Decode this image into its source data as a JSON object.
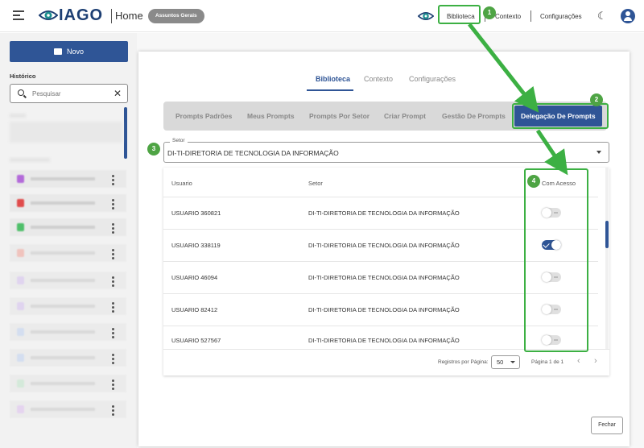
{
  "header": {
    "logo_text": "IAGO",
    "home_title": "Home",
    "chip_label": "Assuntos Gerais",
    "nav": {
      "biblioteca": "Biblioteca",
      "contexto": "Contexto",
      "configuracoes": "Configurações"
    },
    "theme_icon": "moon-icon",
    "avatar_icon": "user-icon"
  },
  "sidebar": {
    "novo_label": "Novo",
    "historico_label": "Histórico",
    "search_placeholder": "Pesquisar"
  },
  "modal": {
    "tabs": [
      "Biblioteca",
      "Contexto",
      "Configurações"
    ],
    "active_tab": "Biblioteca",
    "subtabs": [
      "Prompts Padrões",
      "Meus Prompts",
      "Prompts Por Setor",
      "Criar Prompt",
      "Gestão De Prompts",
      "Delegação De Prompts"
    ],
    "active_subtab": "Delegação De Prompts",
    "setor_label": "Setor",
    "setor_value": "DI-TI-DIRETORIA DE TECNOLOGIA DA INFORMAÇÃO",
    "table": {
      "headers": [
        "Usuario",
        "Setor",
        "Com Acesso"
      ],
      "rows": [
        {
          "usuario": "USUARIO 360821",
          "setor": "DI-TI-DIRETORIA DE TECNOLOGIA DA INFORMAÇÃO",
          "acesso": false
        },
        {
          "usuario": "USUARIO 338119",
          "setor": "DI-TI-DIRETORIA DE TECNOLOGIA DA INFORMAÇÃO",
          "acesso": true
        },
        {
          "usuario": "USUARIO 46094",
          "setor": "DI-TI-DIRETORIA DE TECNOLOGIA DA INFORMAÇÃO",
          "acesso": false
        },
        {
          "usuario": "USUARIO 82412",
          "setor": "DI-TI-DIRETORIA DE TECNOLOGIA DA INFORMAÇÃO",
          "acesso": false
        },
        {
          "usuario": "USUARIO 527567",
          "setor": "DI-TI-DIRETORIA DE TECNOLOGIA DA INFORMAÇÃO",
          "acesso": false
        }
      ]
    },
    "pagination": {
      "rows_per_page_label": "Registros por Página:",
      "rows_per_page_value": "50",
      "page_label": "Página 1 de 1"
    },
    "close_label": "Fechar"
  },
  "annotations": {
    "badges": [
      "1",
      "2",
      "3",
      "4"
    ],
    "color": "#3cb043"
  },
  "colors": {
    "primary": "#2f5596",
    "annotation_green": "#3cb043"
  }
}
